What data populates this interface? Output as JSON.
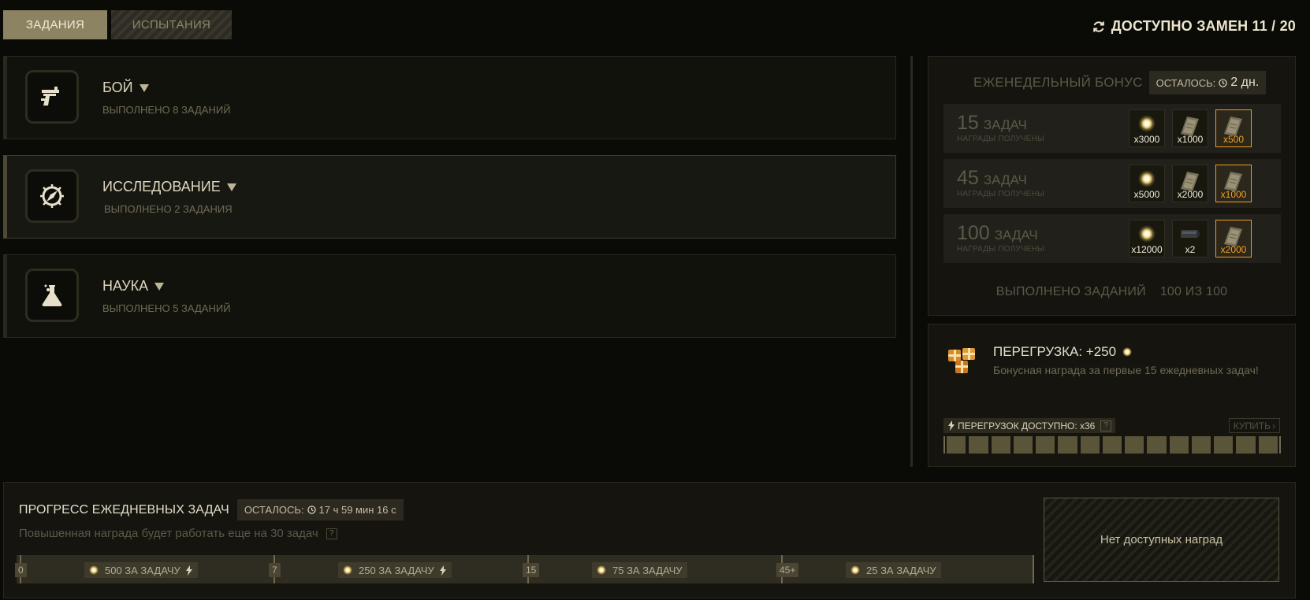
{
  "tabs": [
    "ЗАДАНИЯ",
    "ИСПЫТАНИЯ"
  ],
  "swaps": {
    "label": "ДОСТУПНО ЗАМЕН 11 / 20",
    "icon": "refresh-icon"
  },
  "categories": [
    {
      "title": "БОЙ",
      "subtitle": "ВЫПОЛНЕНО 8 ЗАДАНИЙ",
      "icon": "pistol-icon"
    },
    {
      "title": "ИССЛЕДОВАНИЕ",
      "subtitle": "ВЫПОЛНЕНО 2 ЗАДАНИЯ",
      "icon": "compass-icon"
    },
    {
      "title": "НАУКА",
      "subtitle": "ВЫПОЛНЕНО 5 ЗАДАНИЙ",
      "icon": "flask-icon"
    }
  ],
  "weekly": {
    "title": "ЕЖЕНЕДЕЛЬНЫЙ БОНУС",
    "remaining_label": "ОСТАЛОСЬ:",
    "remaining_value": "2 дн.",
    "rows": [
      {
        "count": "15",
        "unit": "ЗАДАЧ",
        "status": "НАГРАДЫ ПОЛУЧЕНЫ",
        "rewards": [
          {
            "icon": "spark-icon",
            "qty": "x3000"
          },
          {
            "icon": "ticket-icon",
            "qty": "x1000"
          },
          {
            "icon": "ticket-icon",
            "qty": "x500",
            "highlight": true
          }
        ]
      },
      {
        "count": "45",
        "unit": "ЗАДАЧ",
        "status": "НАГРАДЫ ПОЛУЧЕНЫ",
        "rewards": [
          {
            "icon": "spark-icon",
            "qty": "x5000"
          },
          {
            "icon": "ticket-icon",
            "qty": "x2000"
          },
          {
            "icon": "ticket-icon",
            "qty": "x1000",
            "highlight": true
          }
        ]
      },
      {
        "count": "100",
        "unit": "ЗАДАЧ",
        "status": "НАГРАДЫ ПОЛУЧЕНЫ",
        "rewards": [
          {
            "icon": "spark-icon",
            "qty": "x12000"
          },
          {
            "icon": "module-icon",
            "qty": "x2"
          },
          {
            "icon": "ticket-icon",
            "qty": "x2000",
            "highlight": true
          }
        ]
      }
    ],
    "footer_label": "ВЫПОЛНЕНО ЗАДАНИЙ",
    "footer_value": "100 ИЗ 100"
  },
  "overload": {
    "title": "ПЕРЕГРУЗКА: +250",
    "description": "Бонусная награда за первые 15 ежедневных задач!",
    "available": "ПЕРЕГРУЗОК ДОСТУПНО: x36",
    "help": "?",
    "buy": "КУПИТЬ",
    "segments": 15,
    "filled": 15
  },
  "daily": {
    "title": "ПРОГРЕСС ЕЖЕДНЕВНЫХ ЗАДАЧ",
    "remaining_label": "ОСТАЛОСЬ:",
    "remaining_value": "17 ч 59 мин 16 с",
    "subtitle": "Повышенная награда будет работать еще на 30 задач",
    "help": "?",
    "milestones": [
      {
        "mark": "0",
        "reward": "500 ЗА ЗАДАЧУ",
        "boost": true
      },
      {
        "mark": "7",
        "reward": "250 ЗА ЗАДАЧУ",
        "boost": true
      },
      {
        "mark": "15",
        "reward": "75 ЗА ЗАДАЧУ",
        "boost": false
      },
      {
        "mark": "45+",
        "reward": "25 ЗА ЗАДАЧУ",
        "boost": false
      }
    ],
    "no_rewards": "Нет доступных наград"
  }
}
